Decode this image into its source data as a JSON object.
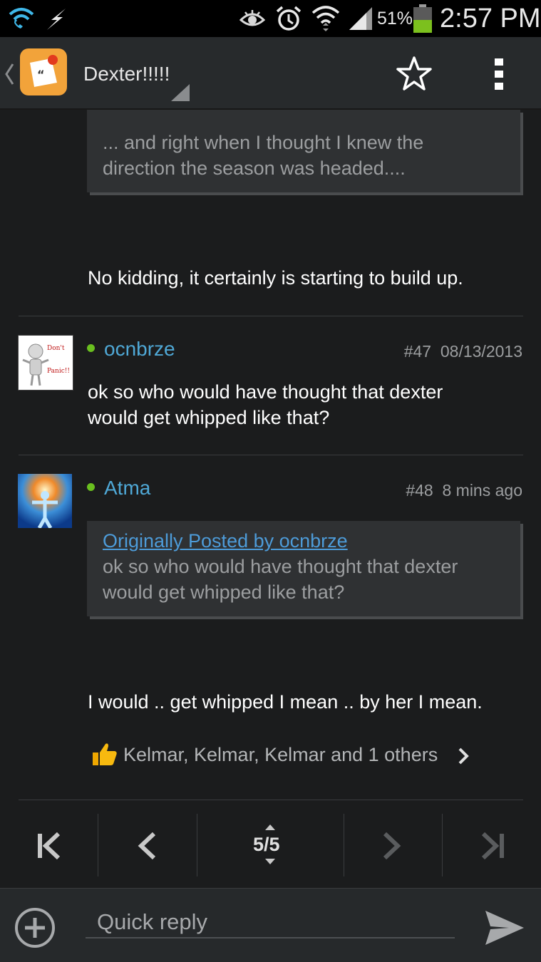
{
  "status_bar": {
    "battery": "51%",
    "time": "2:57 PM"
  },
  "header": {
    "title": "Dexter!!!!!"
  },
  "posts": [
    {
      "quote_text": "... and right when I thought I knew the direction the season was headed....",
      "body_lines": [
        "No kidding, it certainly is starting to build up."
      ]
    },
    {
      "username": "ocnbrze",
      "number": "#47",
      "date": "08/13/2013",
      "avatar_text": [
        "Don't",
        "Panic!!"
      ],
      "body_lines": [
        "ok so who would have thought that dexter",
        "would get whipped like that?"
      ]
    },
    {
      "username": "Atma",
      "number": "#48",
      "date": "8 mins ago",
      "quote_link": "Originally Posted by ocnbrze",
      "quote_lines": [
        "ok so who would have thought that dexter",
        "would get whipped like that?"
      ],
      "body_lines": [
        "I would .. get whipped I mean .. by her I mean."
      ],
      "likes": "Kelmar, Kelmar, Kelmar and 1 others"
    }
  ],
  "pagination": {
    "page": "5/5"
  },
  "reply": {
    "placeholder": "Quick reply"
  },
  "colors": {
    "accent": "#4fa8d6",
    "online": "#6abf1f",
    "battery": "#7cc01e"
  }
}
